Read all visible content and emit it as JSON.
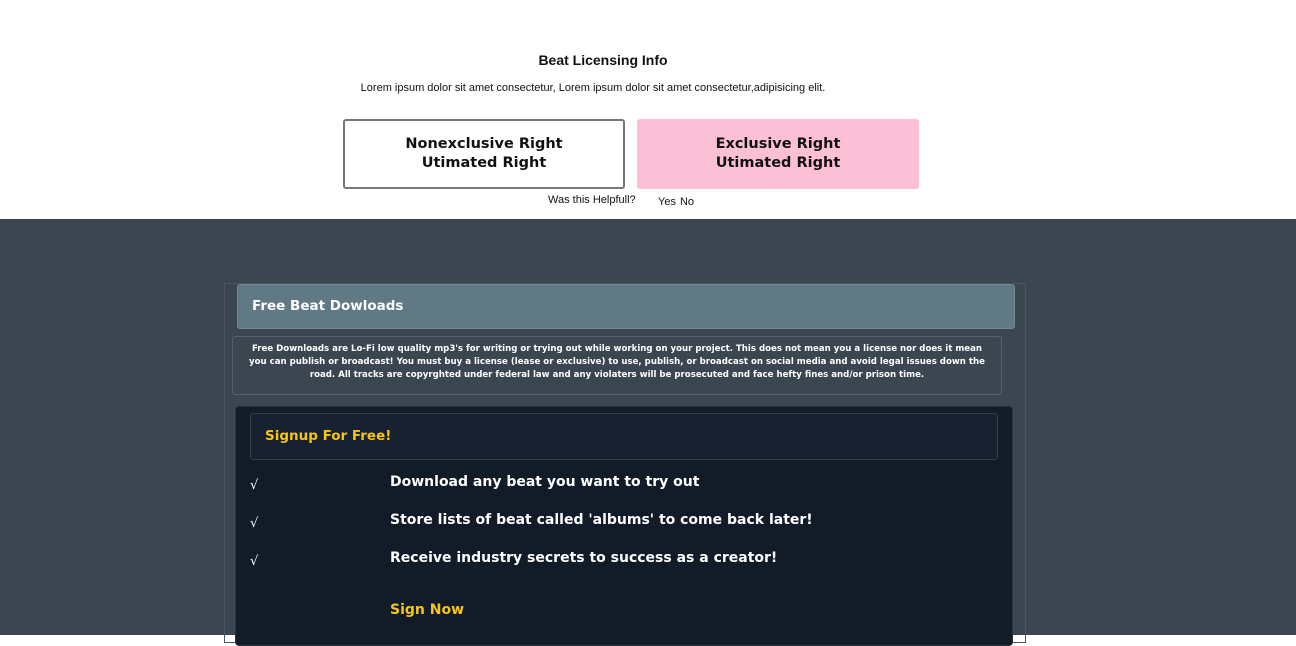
{
  "licensing": {
    "title": "Beat Licensing Info",
    "subtitle": "Lorem ipsum dolor sit amet consectetur, Lorem ipsum dolor sit amet consectetur,adipisicing elit.",
    "nonexclusive": {
      "line1": "Nonexclusive Right",
      "line2": "Utimated Right"
    },
    "exclusive": {
      "line1": "Exclusive Right",
      "line2": "Utimated Right",
      "color": "#fcc0d6"
    },
    "helpful": {
      "question": "Was this Helpfull?",
      "yes": "Yes",
      "no": "No"
    }
  },
  "downloads": {
    "header": "Free Beat Dowloads",
    "disclaimer": "Free Downloads are Lo-Fi low quality mp3's for writing or trying out while working on your project. This does not mean you a license nor does it mean you can publish or broadcast! You must buy a license (lease or exclusive) to use, publish, or broadcast on social media and avoid legal issues down the road. All tracks are copyrghted under federal law and any violaters will be prosecuted and face hefty fines and/or prison time.",
    "signup": {
      "title": "Signup For Free!",
      "features": [
        {
          "check": "√",
          "text": "Download any beat you want to try out"
        },
        {
          "check": "√",
          "text": "Store lists of beat called 'albums' to come back later!"
        },
        {
          "check": "√",
          "text": "Receive industry secrets to success as a creator!"
        }
      ],
      "cta": "Sign Now"
    },
    "accent_color": "#f5c518",
    "background_color": "#3c4651"
  }
}
